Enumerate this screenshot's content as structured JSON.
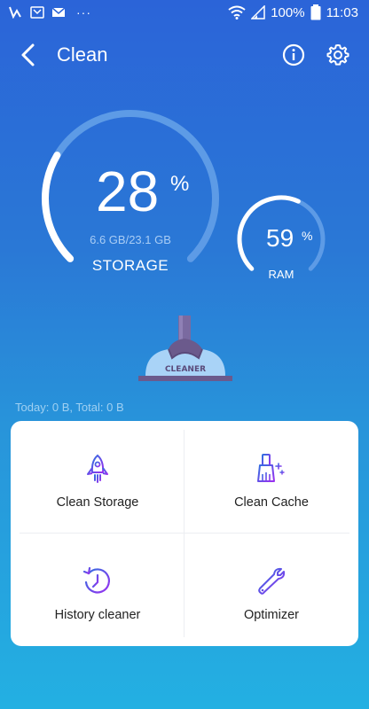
{
  "status_bar": {
    "battery": "100%",
    "time": "11:03",
    "overflow": "···"
  },
  "toolbar": {
    "title": "Clean",
    "back_icon": "back-arrow-icon",
    "info_icon": "info-icon",
    "settings_icon": "gear-icon"
  },
  "storage": {
    "percent": "28",
    "percent_sign": "%",
    "size": "6.6 GB/23.1 GB",
    "label": "STORAGE",
    "fill_fraction": 0.28
  },
  "ram": {
    "percent": "59",
    "percent_sign": "%",
    "label": "RAM",
    "fill_fraction": 0.59
  },
  "illustration": {
    "label": "CLEANER"
  },
  "summary": {
    "text": "Today:  0 B, Total:  0 B"
  },
  "actions": [
    {
      "label": "Clean Storage",
      "icon": "rocket-icon"
    },
    {
      "label": "Clean Cache",
      "icon": "broom-icon"
    },
    {
      "label": "History cleaner",
      "icon": "history-icon"
    },
    {
      "label": "Optimizer",
      "icon": "wrench-icon"
    }
  ],
  "colors": {
    "accent_purple": "#8a3df0",
    "accent_blue": "#2f6fe0",
    "gauge_track": "#5d9be6"
  }
}
